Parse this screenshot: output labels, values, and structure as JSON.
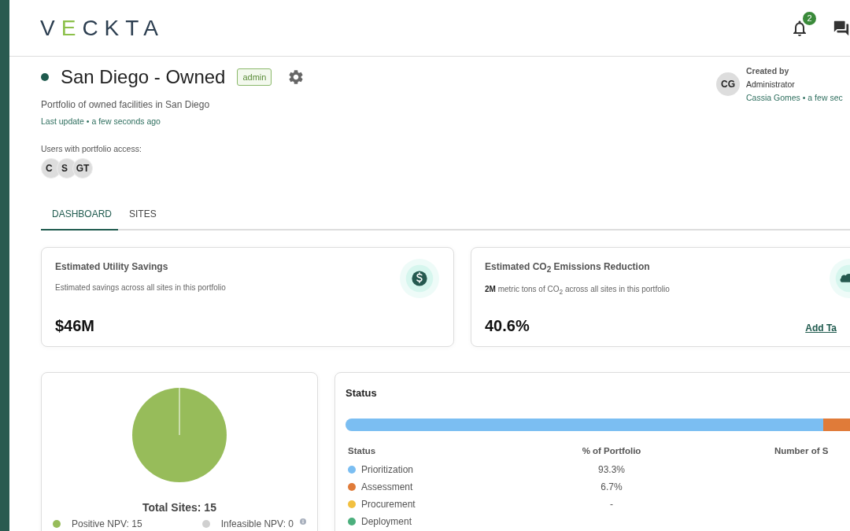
{
  "header": {
    "logo": "VECKTA",
    "notifications": "2"
  },
  "portfolio": {
    "title": "San Diego - Owned",
    "role": "admin",
    "description": "Portfolio of owned facilities in San Diego",
    "last_update": "Last update • a few seconds ago",
    "access_label": "Users with portfolio access:",
    "users": [
      "C",
      "S",
      "GT"
    ]
  },
  "created": {
    "label": "Created by",
    "avatar": "CG",
    "role": "Administrator",
    "author": "Cassia Gomes • a few sec"
  },
  "tabs": [
    {
      "label": "DASHBOARD",
      "selected": true
    },
    {
      "label": "SITES",
      "selected": false
    }
  ],
  "metrics": [
    {
      "kind": "dollar",
      "title": "Estimated Utility Savings",
      "subtitle": "Estimated savings across all sites in this portfolio",
      "value": "$46M"
    },
    {
      "kind": "co2",
      "title": "Estimated CO$_{2}$ Emissions Reduction",
      "subtitle": "**2M** metric tons of CO$_{2}$ across all sites in this portfolio",
      "value": "40.6%",
      "link": "Add Ta"
    }
  ],
  "sites": {
    "total": "Total Sites: 15",
    "legend": [
      {
        "label": "Positive NPV: 15",
        "color": "#97bc5a",
        "info": false
      },
      {
        "label": "Infeasible NPV: 0",
        "color": "#d0d0d0",
        "info": true
      }
    ]
  },
  "status": {
    "title": "Status",
    "columns": [
      "Status",
      "% of Portfolio",
      "Number of S"
    ],
    "rows": [
      {
        "name": "Prioritization",
        "percent": "93.3%",
        "color": "#7bbef2",
        "level": 0.933
      },
      {
        "name": "Assessment",
        "percent": "6.7%",
        "color": "#e07b39",
        "level": 0.067
      },
      {
        "name": "Procurement",
        "percent": "-",
        "color": "#f2c040",
        "level": 0
      },
      {
        "name": "Deployment",
        "color": "#4caf7d",
        "level": 0
      }
    ]
  }
}
